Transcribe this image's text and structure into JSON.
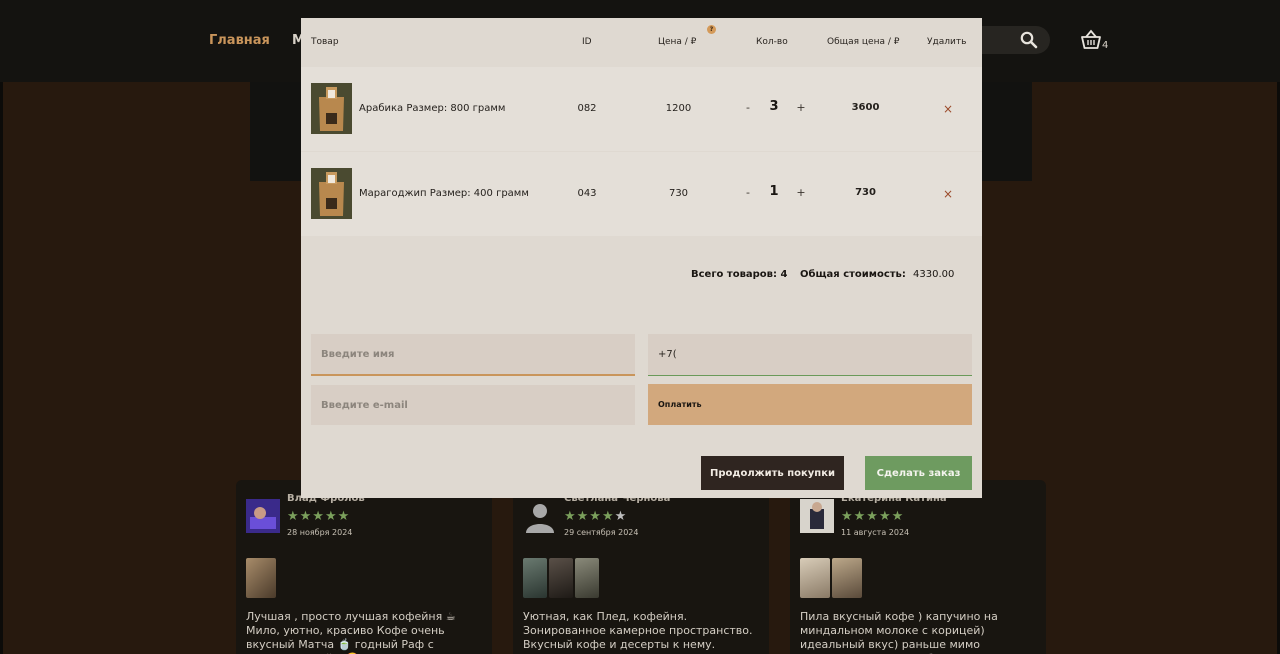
{
  "nav": {
    "home_label": "Главная",
    "next_label_partial": "М",
    "basket_count": "4"
  },
  "cart": {
    "headers": {
      "product": "Товар",
      "id": "ID",
      "price": "Цена / ₽",
      "qty": "Кол-во",
      "total": "Общая цена / ₽",
      "remove": "Удалить"
    },
    "help_badge": "?",
    "items": [
      {
        "name": "Арабика Размер: 800 грамм",
        "id": "082",
        "price": "1200",
        "qty": "3",
        "total": "3600",
        "minus": "-",
        "plus": "+",
        "remove": "×"
      },
      {
        "name": "Марагоджип Размер: 400 грамм",
        "id": "043",
        "price": "730",
        "qty": "1",
        "total": "730",
        "minus": "-",
        "plus": "+",
        "remove": "×"
      }
    ],
    "summary": {
      "count_label": "Всего товаров: 4",
      "cost_label": "Общая стоимость:",
      "cost_value": "4330.00"
    }
  },
  "form": {
    "name_placeholder": "Введите имя",
    "name_value": "",
    "phone_value": "+7(",
    "email_placeholder": "Введите e-mail",
    "email_value": "",
    "pay_label": "Оплатить"
  },
  "actions": {
    "continue_label": "Продолжить покупки",
    "order_label": "Сделать заказ"
  },
  "reviews": [
    {
      "name": "Влад Фролов",
      "stars": "★★★★★",
      "date": "28 ноября 2024",
      "text": "Лучшая , просто лучшая кофейня ☕ Мило, уютно, красиво Кофе очень вкусный Матча 🍵 годный Раф с арахисом - кайф 🤩 Раф..."
    },
    {
      "name": "Светлана Чернова",
      "stars": "★★★★★",
      "date": "29 сентября 2024",
      "text": "Уютная, как Плед, кофейня. Зонированное камерное пространство. Вкусный кофе и десерты к нему. Неожиданно приятное место..."
    },
    {
      "name": "Екатерина Катина",
      "stars": "★★★★★",
      "date": "11 августа 2024",
      "text": "Пила вкусный кофе ) капучино на миндальном молоке с корицей) идеальный вкус) раньше мимо проходила ))) теперь бу..."
    }
  ],
  "colors": {
    "accent": "#c9955b",
    "modal_bg": "#dfd9d1",
    "pay_button": "#d2a87d",
    "order_button": "#6e9b60",
    "continue_button": "#2f2520",
    "stars": "#7ba05c"
  }
}
